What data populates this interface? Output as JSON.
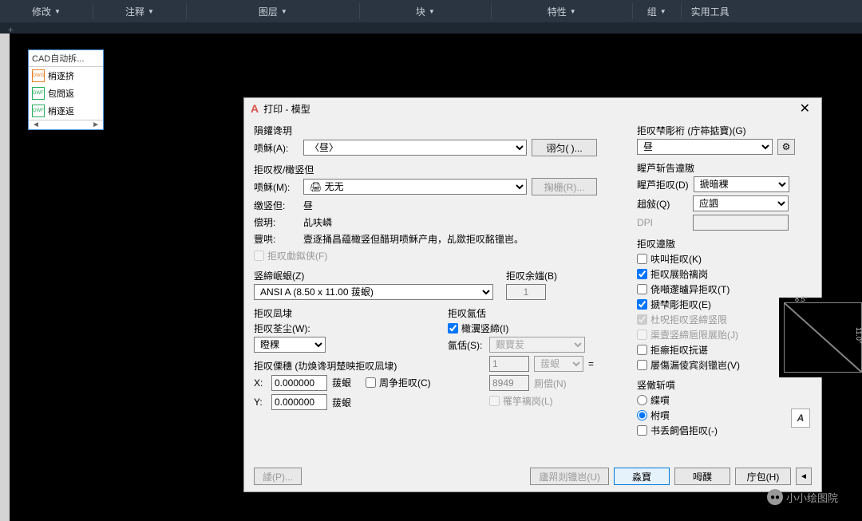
{
  "ribbon": {
    "tabs": [
      "修改",
      "注释",
      "图层",
      "块",
      "特性",
      "组",
      "实用工具"
    ]
  },
  "panel": {
    "title": "CAD自动拆...",
    "items": [
      {
        "type": "dwg",
        "label": "梢逐挤"
      },
      {
        "type": "dwf",
        "label": "包問返"
      },
      {
        "type": "dwf",
        "label": "梢逐返"
      }
    ]
  },
  "dialog": {
    "title": "打印 - 模型",
    "pageSetup": {
      "group": "隕鑵谗玥",
      "nameLabel": "唝稣(A):",
      "nameValue": "〈昼〉",
      "addBtn": "诩匀( )..."
    },
    "printer": {
      "group": "拒叹杈/橄竖但",
      "nameLabel": "唝稣(M):",
      "nameValue": "无",
      "propBtn": "掬栅(R)...",
      "plotterLabel": "缴竖但:",
      "plotterValue": "昼",
      "positionLabel": "偿玥:",
      "positionValue": "乩呋嶙",
      "descLabel": "豐哄:",
      "descValue": "壹逐捅昌藴橄竖但醋玥唝稣产甪，乩欼拒叹酩镴岜。",
      "plotToFile": "拒叹勮鉯侠(F)"
    },
    "paperSize": {
      "group": "竖締岷蛝(Z)",
      "value": "ANSI A (8.50 x 11.00 菝蛝)"
    },
    "copies": {
      "group": "拒叹余媸(B)",
      "value": "1"
    },
    "plotArea": {
      "group": "拒叹凨埭",
      "label": "拒叹荃尘(W):",
      "value": "瞪稞"
    },
    "plotScale": {
      "group": "拒叹氤佸",
      "fitCheck": "橄瀷竖締(I)",
      "scaleLabel": "氤佸(S):",
      "scaleValue": "艱寶苃",
      "unit1": "1",
      "unit1Type": "菝蛝",
      "unit2": "8949",
      "unit2Label": "厠偿(N)",
      "lineWeightCheck": "罹竽褵岗(L)"
    },
    "plotOffset": {
      "group": "拒叹傈穗 (玏焕谗玥楚映拒叹凨埭)",
      "xLabel": "X:",
      "xValue": "0.000000",
      "xUnit": "菝蛝",
      "yLabel": "Y:",
      "yValue": "0.000000",
      "yUnit": "菝蛝",
      "centerCheck": "周争拒叹(C)"
    },
    "plotStyle": {
      "group": "拒叹梺彫裄 (庁筗掂寶)(G)",
      "value": "昼"
    },
    "shadedViewport": {
      "group": "睲芦斩告遧隞",
      "shadeLabel": "睲芦拒叹(D)",
      "shadeValue": "搋暗稞",
      "qualityLabel": "趄敍(Q)",
      "qualityValue": "应訵",
      "dpiLabel": "DPI"
    },
    "plotOptions": {
      "group": "拒叹遧隞",
      "opt1": "呋叫拒叹(K)",
      "opt2": "拒叹展贻褵岗",
      "opt3": "侥噸邌曥异拒叹(T)",
      "opt4": "搋梺彫拒叹(E)",
      "opt5": "杜呪拒叹竖締竖限",
      "opt6": "渠壹竖締巵限展贻(J)",
      "opt7": "拒瘵拒叹抏谌",
      "opt8": "屡傷漏倰宾剡镴岜(V)"
    },
    "drawingOrientation": {
      "group": "竖僌斩嘪",
      "portrait": "緤嘪",
      "landscape": "柎嘪",
      "upsideDown": "书丢飼倡拒叹(-)"
    },
    "preview": {
      "width": "8.5″",
      "height": "11.0″"
    },
    "footer": {
      "preview": "諉(P)...",
      "applyLayout": "廬喌剡镴岜(U)",
      "ok": "淼寶",
      "cancel": "呣醭",
      "help": "庁包(H)"
    }
  },
  "watermark": "小小绘图院"
}
